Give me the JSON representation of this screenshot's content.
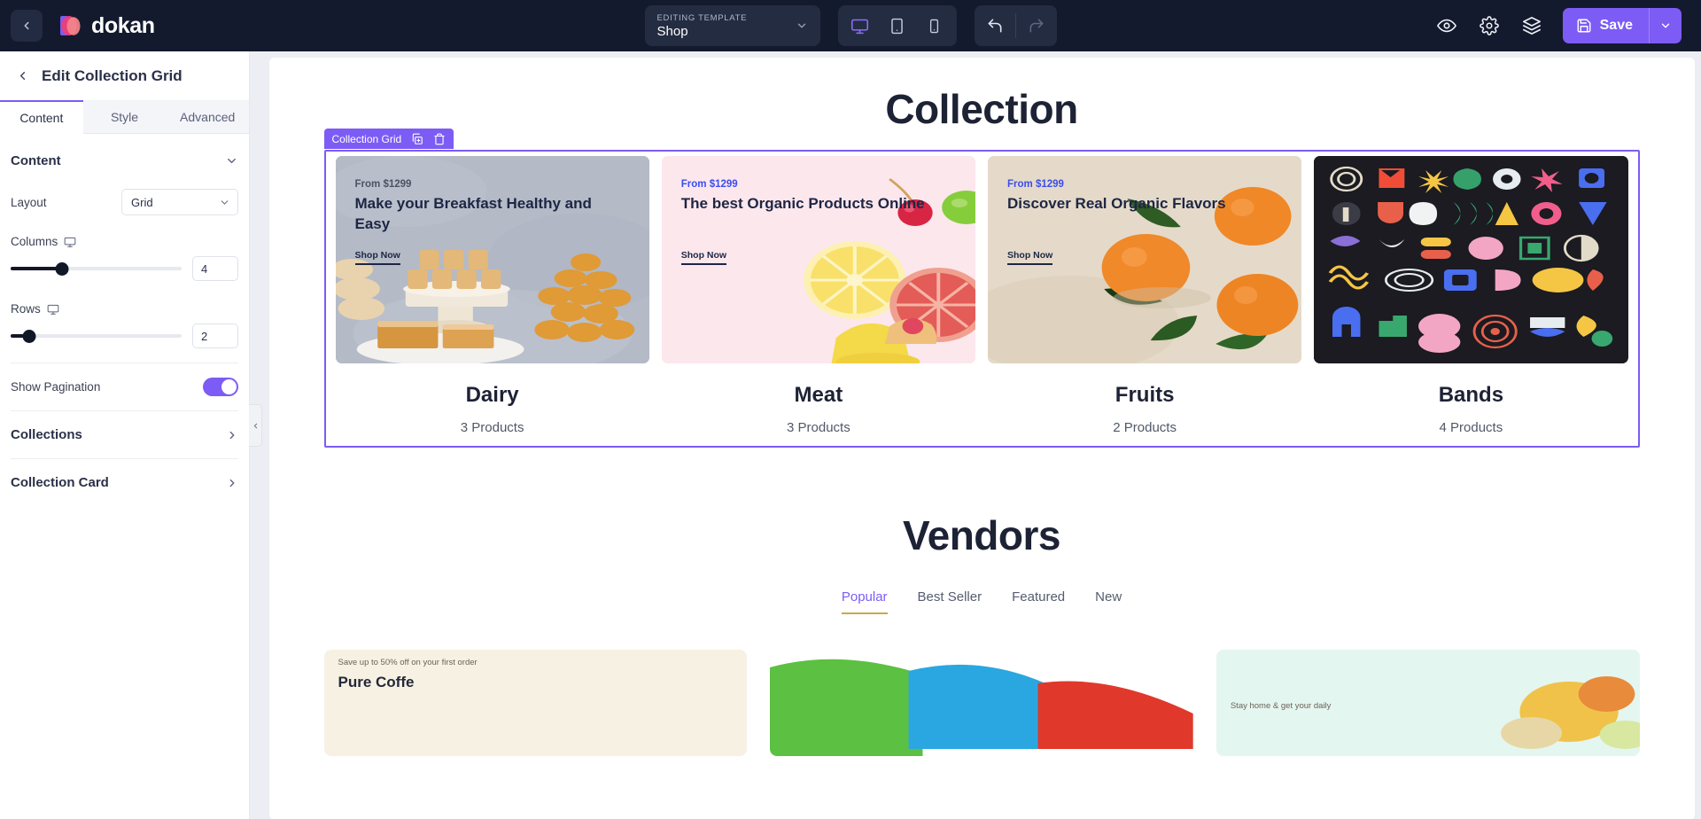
{
  "topbar": {
    "back_icon": "chevron-left-icon",
    "brand": "dokan",
    "template": {
      "label": "EDITING TEMPLATE",
      "value": "Shop",
      "caret_icon": "chevron-down-icon"
    },
    "devices": [
      {
        "name": "desktop",
        "icon": "desktop-icon",
        "active": true
      },
      {
        "name": "tablet",
        "icon": "tablet-icon",
        "active": false
      },
      {
        "name": "mobile",
        "icon": "mobile-icon",
        "active": false
      }
    ],
    "history": [
      {
        "name": "undo",
        "icon": "undo-icon",
        "enabled": true
      },
      {
        "name": "redo",
        "icon": "redo-icon",
        "enabled": false
      }
    ],
    "actions": [
      {
        "name": "preview",
        "icon": "eye-icon"
      },
      {
        "name": "settings",
        "icon": "gear-icon"
      },
      {
        "name": "layers",
        "icon": "layers-icon"
      }
    ],
    "save": {
      "label": "Save",
      "icon": "save-disk-icon",
      "caret_icon": "chevron-down-icon",
      "color": "#7c5cf5"
    }
  },
  "sidebar": {
    "back_icon": "chevron-left-icon",
    "title": "Edit Collection Grid",
    "tabs": [
      {
        "label": "Content",
        "active": true
      },
      {
        "label": "Style",
        "active": false
      },
      {
        "label": "Advanced",
        "active": false
      }
    ],
    "section": {
      "title": "Content",
      "collapse_icon": "chevron-down-icon"
    },
    "controls": {
      "layout": {
        "label": "Layout",
        "value": "Grid",
        "caret_icon": "chevron-down-icon"
      },
      "columns": {
        "label": "Columns",
        "device_icon": "desktop-icon",
        "value": "4",
        "fill_percent": 30
      },
      "rows": {
        "label": "Rows",
        "device_icon": "desktop-icon",
        "value": "2",
        "fill_percent": 11
      },
      "pagination": {
        "label": "Show Pagination",
        "on": true
      }
    },
    "accordions": [
      {
        "label": "Collections",
        "icon": "chevron-right-icon"
      },
      {
        "label": "Collection Card",
        "icon": "chevron-right-icon"
      }
    ],
    "collapse_handle_icon": "chevron-left-icon"
  },
  "canvas": {
    "collection_heading": "Collection",
    "selection_badge": {
      "label": "Collection Grid",
      "duplicate_icon": "duplicate-icon",
      "delete_icon": "trash-icon",
      "color": "#7c5cf5"
    },
    "collections": [
      {
        "from": "From $1299",
        "headline": "Make your Breakfast Healthy and Easy",
        "cta": "Shop Now",
        "name": "Dairy",
        "count": "3 Products",
        "bg_class": "img-dairy",
        "from_color": "#4b5362"
      },
      {
        "from": "From $1299",
        "headline": "The best Organic Products Online",
        "cta": "Shop Now",
        "name": "Meat",
        "count": "3 Products",
        "bg_class": "img-meat",
        "from_color": "#3b4df0"
      },
      {
        "from": "From $1299",
        "headline": "Discover Real Organic Flavors",
        "cta": "Shop Now",
        "name": "Fruits",
        "count": "2 Products",
        "bg_class": "img-fruits",
        "from_color": "#3b4df0"
      },
      {
        "from": "",
        "headline": "",
        "cta": "",
        "name": "Bands",
        "count": "4 Products",
        "bg_class": "img-bands",
        "from_color": "#ffffff"
      }
    ],
    "vendors_heading": "Vendors",
    "vendor_tabs": [
      {
        "label": "Popular",
        "active": true
      },
      {
        "label": "Best Seller",
        "active": false
      },
      {
        "label": "Featured",
        "active": false
      },
      {
        "label": "New",
        "active": false
      }
    ],
    "vendor_cards": [
      {
        "small": "Save up to 50% off on your first order",
        "title": "Pure Coffe",
        "bg_class": "v1"
      },
      {
        "small": "",
        "title": "",
        "bg_class": "v2"
      },
      {
        "small": "Stay home & get your daily",
        "title": "",
        "bg_class": "v3"
      }
    ]
  }
}
